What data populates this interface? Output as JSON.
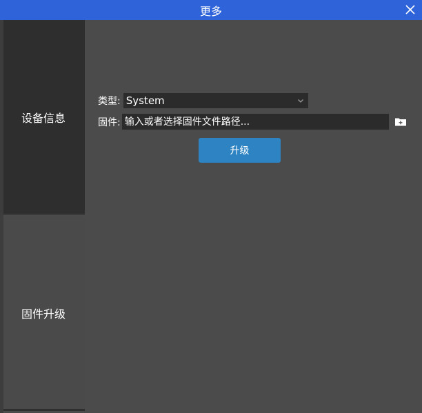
{
  "window": {
    "title": "更多"
  },
  "sidebar": {
    "tabs": [
      {
        "label": "设备信息",
        "active": true
      },
      {
        "label": "固件升级",
        "active": false
      }
    ]
  },
  "form": {
    "type_label": "类型:",
    "type_value": "System",
    "firmware_label": "固件:",
    "firmware_placeholder": "输入或者选择固件文件路径...",
    "firmware_value": "",
    "upgrade_label": "升级"
  },
  "icons": {
    "close": "close-icon",
    "dropdown": "chevron-down-icon",
    "browse": "folder-add-icon"
  },
  "colors": {
    "titlebar": "#2f63d9",
    "background": "#4b4b4b",
    "sidebar_active": "#2e2e2e",
    "field_bg": "#2b2b2b",
    "accent_button": "#2e84c2"
  }
}
